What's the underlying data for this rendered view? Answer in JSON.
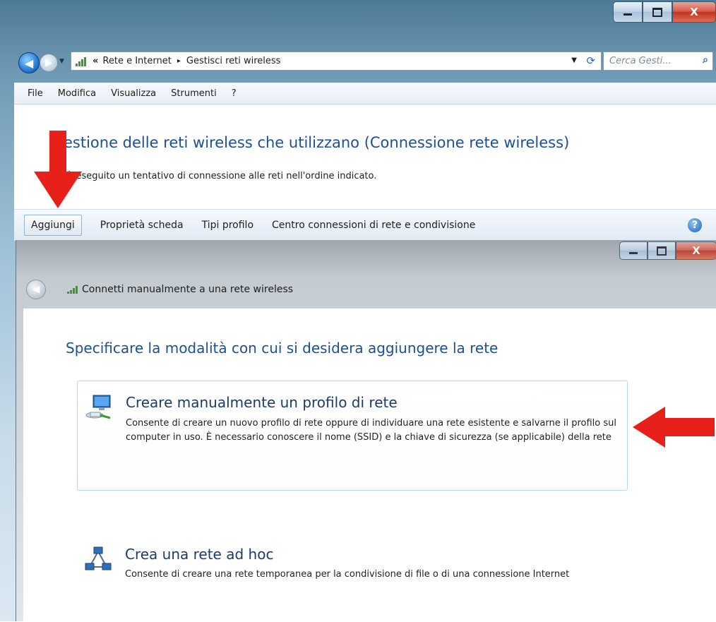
{
  "outer_window": {
    "address": {
      "prefix_chevron": "«",
      "crumbs": [
        "Rete e Internet",
        "Gestisci reti wireless"
      ],
      "separator": "▸"
    },
    "search_placeholder": "Cerca Gesti...",
    "menu": [
      "File",
      "Modifica",
      "Visualizza",
      "Strumenti",
      "?"
    ],
    "heading": "estione delle reti wireless che utilizzano (Connessione rete wireless)",
    "subtext": "rà eseguito un tentativo di connessione alle reti nell'ordine indicato.",
    "commands": [
      "Aggiungi",
      "Proprietà scheda",
      "Tipi profilo",
      "Centro connessioni di rete e condivisione"
    ],
    "help_glyph": "?"
  },
  "dialog": {
    "title": "Connetti manualmente a una rete wireless",
    "heading": "Specificare la modalità con cui si desidera aggiungere la rete",
    "options": [
      {
        "title": "Creare manualmente un profilo di rete",
        "description": "Consente di creare un nuovo profilo di rete oppure di individuare una rete esistente e salvarne il profilo sul computer in uso. È necessario conoscere il nome (SSID) e la chiave di sicurezza (se applicabile) della rete",
        "icon": "network-computer-icon"
      },
      {
        "title": "Crea una rete ad hoc",
        "description": "Consente di creare una rete temporanea per la condivisione di file o di una connessione Internet",
        "icon": "adhoc-network-icon"
      }
    ]
  },
  "colors": {
    "heading_blue": "#1e4f92",
    "arrow_red": "#e8201a",
    "signal_green": "#3a9a2c"
  }
}
